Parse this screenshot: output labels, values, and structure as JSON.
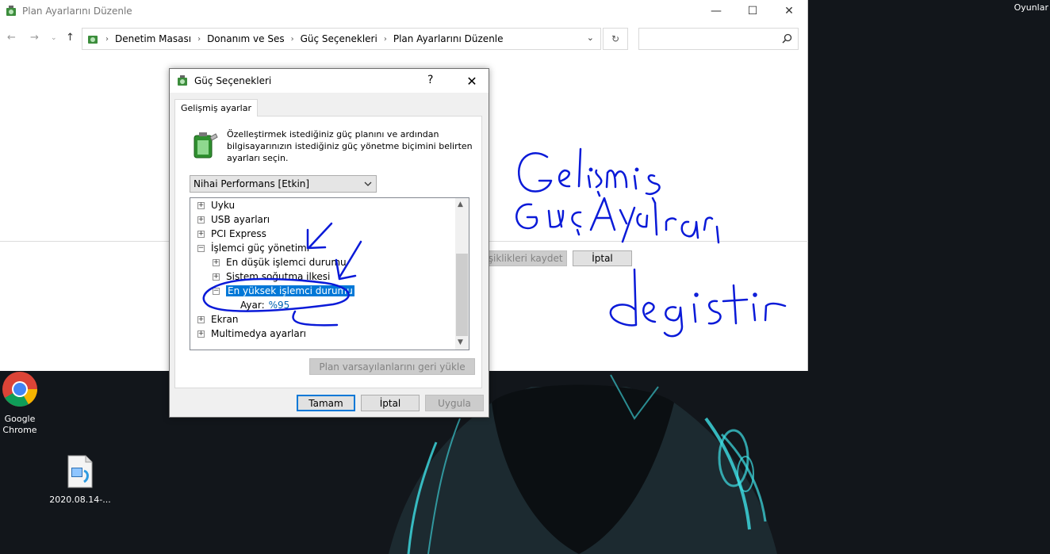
{
  "desktop": {
    "corner_label": "Oyunlar",
    "icons": [
      {
        "label": "Google Chrome"
      },
      {
        "label": "2020.08.14-..."
      }
    ]
  },
  "explorer": {
    "title": "Plan Ayarlarını Düzenle",
    "breadcrumb": [
      "Denetim Masası",
      "Donanım ve Ses",
      "Güç Seçenekleri",
      "Plan Ayarlarını Düzenle"
    ],
    "search_placeholder": "",
    "bg_buttons": {
      "save": "ışiklikleri kaydet",
      "cancel": "İptal"
    }
  },
  "dialog": {
    "title": "Güç Seçenekleri",
    "help": "?",
    "tab": "Gelişmiş ayarlar",
    "intro": "Özelleştirmek istediğiniz güç planını ve ardından bilgisayarınızın istediğiniz güç yönetme biçimini belirten ayarları seçin.",
    "plan_selected": "Nihai Performans [Etkin]",
    "tree": [
      {
        "label": "Uyku",
        "expander": "+"
      },
      {
        "label": "USB ayarları",
        "expander": "+"
      },
      {
        "label": "PCI Express",
        "expander": "+"
      },
      {
        "label": "İşlemci güç yönetimi",
        "expander": "−"
      },
      {
        "label": "En düşük işlemci durumu",
        "expander": "+"
      },
      {
        "label": "Sistem soğutma ilkesi",
        "expander": "+"
      },
      {
        "label": "En yüksek işlemci durumu",
        "expander": "−"
      },
      {
        "label": "Ayar:",
        "value": "%95"
      },
      {
        "label": "Ekran",
        "expander": "+"
      },
      {
        "label": "Multimedya ayarları",
        "expander": "+"
      }
    ],
    "restore_button": "Plan varsayılanlarını geri yükle",
    "ok_button": "Tamam",
    "cancel_button": "İptal",
    "apply_button": "Uygula"
  },
  "colors": {
    "selection": "#0078d7",
    "ink": "#0a1ad8",
    "glow": "#3fe0e6"
  }
}
